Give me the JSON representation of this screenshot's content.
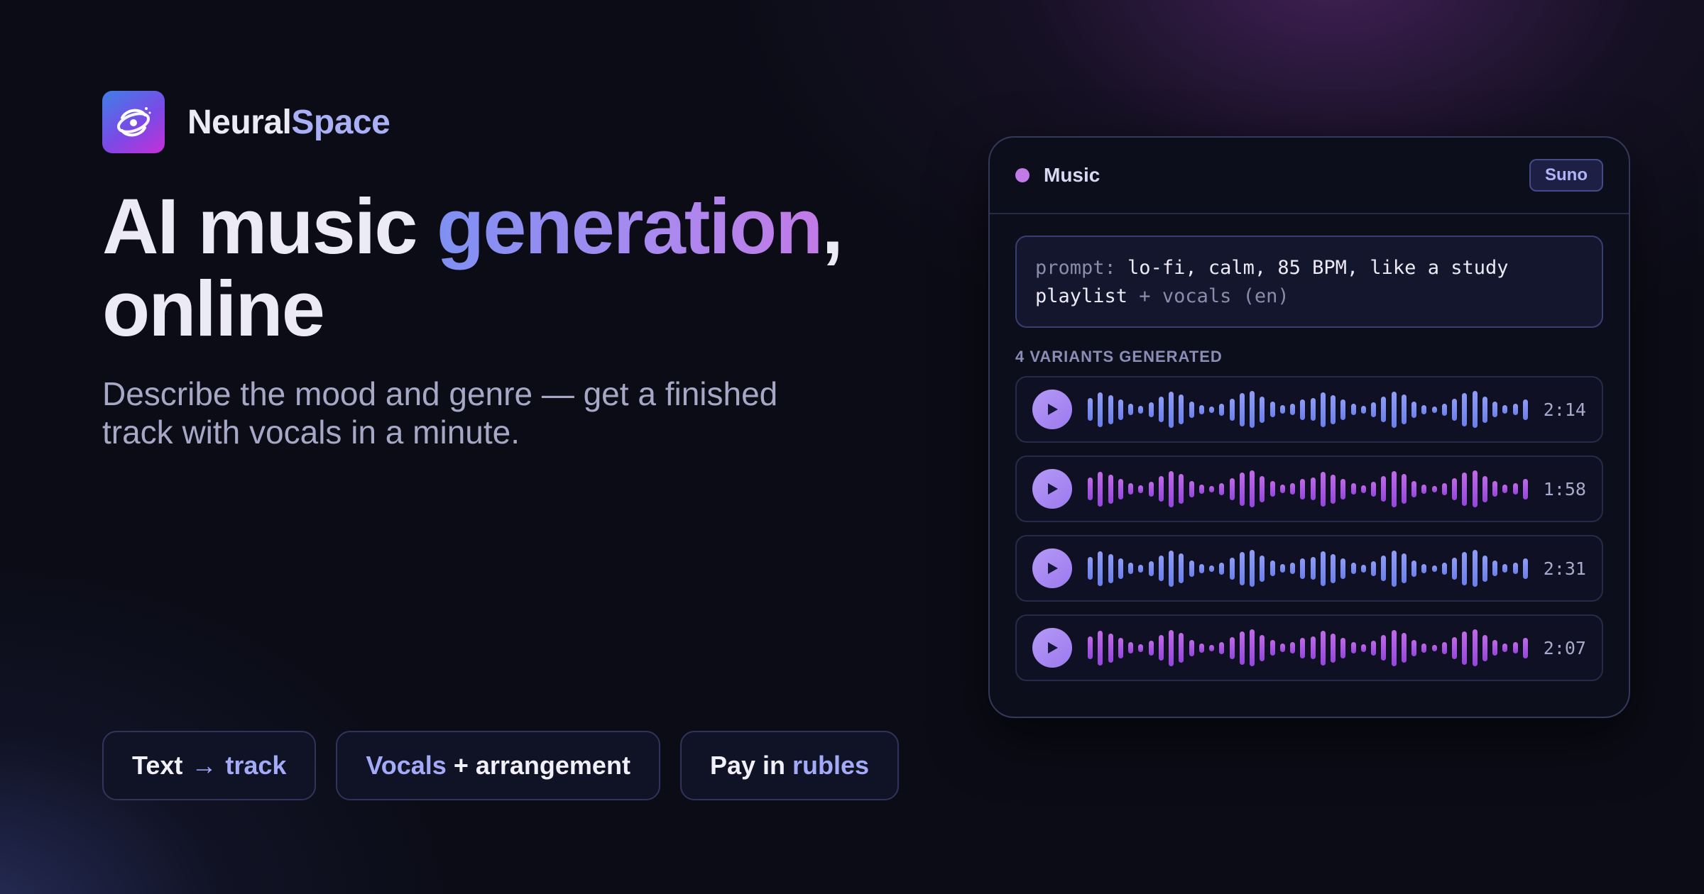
{
  "brand": {
    "name_part1": "Neural",
    "name_part2": "Space",
    "logo_icon": "galaxy-swirl-icon"
  },
  "hero": {
    "title_part1": "AI music ",
    "title_highlight": "generation",
    "title_comma": ",",
    "title_part2": "online",
    "subtitle": "Describe the mood and genre — get a finished track with vocals in a minute."
  },
  "features": [
    {
      "text1": "Text",
      "arrow": "→",
      "text2": "track"
    },
    {
      "text1": "Vocals",
      "text2": " + arrangement"
    },
    {
      "text1": "Pay in ",
      "text2": "rubles"
    }
  ],
  "card": {
    "title": "Music",
    "badge": "Suno",
    "accent_color": "#c27ae6",
    "prompt": {
      "label": "prompt:",
      "text": " lo-fi, calm, 85 BPM, like a study playlist",
      "suffix": " + vocals (en)"
    },
    "variants_label": "4 VARIANTS GENERATED",
    "tracks": [
      {
        "duration": "2:14",
        "color": "#7f90f2"
      },
      {
        "duration": "1:58",
        "color": "#b35ee6"
      },
      {
        "duration": "2:31",
        "color": "#7f90f2"
      },
      {
        "duration": "2:07",
        "color": "#b35ee6"
      }
    ]
  }
}
